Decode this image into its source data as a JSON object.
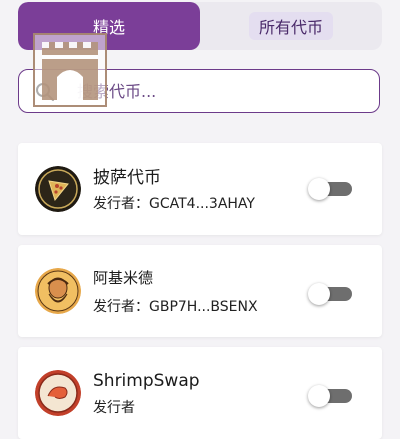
{
  "tabs": [
    {
      "label": "精选",
      "active": true
    },
    {
      "label": "所有代币",
      "active": false
    }
  ],
  "search": {
    "placeholder": "搜索代币..."
  },
  "tokens": [
    {
      "name": "披萨代币",
      "issuer": "发行者：GCAT4...3AHAY",
      "enabled": false,
      "avatar_icon": "pizza-icon"
    },
    {
      "name": "阿基米德",
      "issuer": "发行者：GBP7H...BSENX",
      "enabled": false,
      "avatar_icon": "archimedes-portrait-icon"
    },
    {
      "name": "ShrimpSwap",
      "issuer": "发行者",
      "enabled": false,
      "avatar_icon": "shrimp-icon"
    }
  ],
  "colors": {
    "accent": "#7b3e98",
    "border": "#6c3a8a",
    "toggle_track": "#6e6e6e"
  }
}
